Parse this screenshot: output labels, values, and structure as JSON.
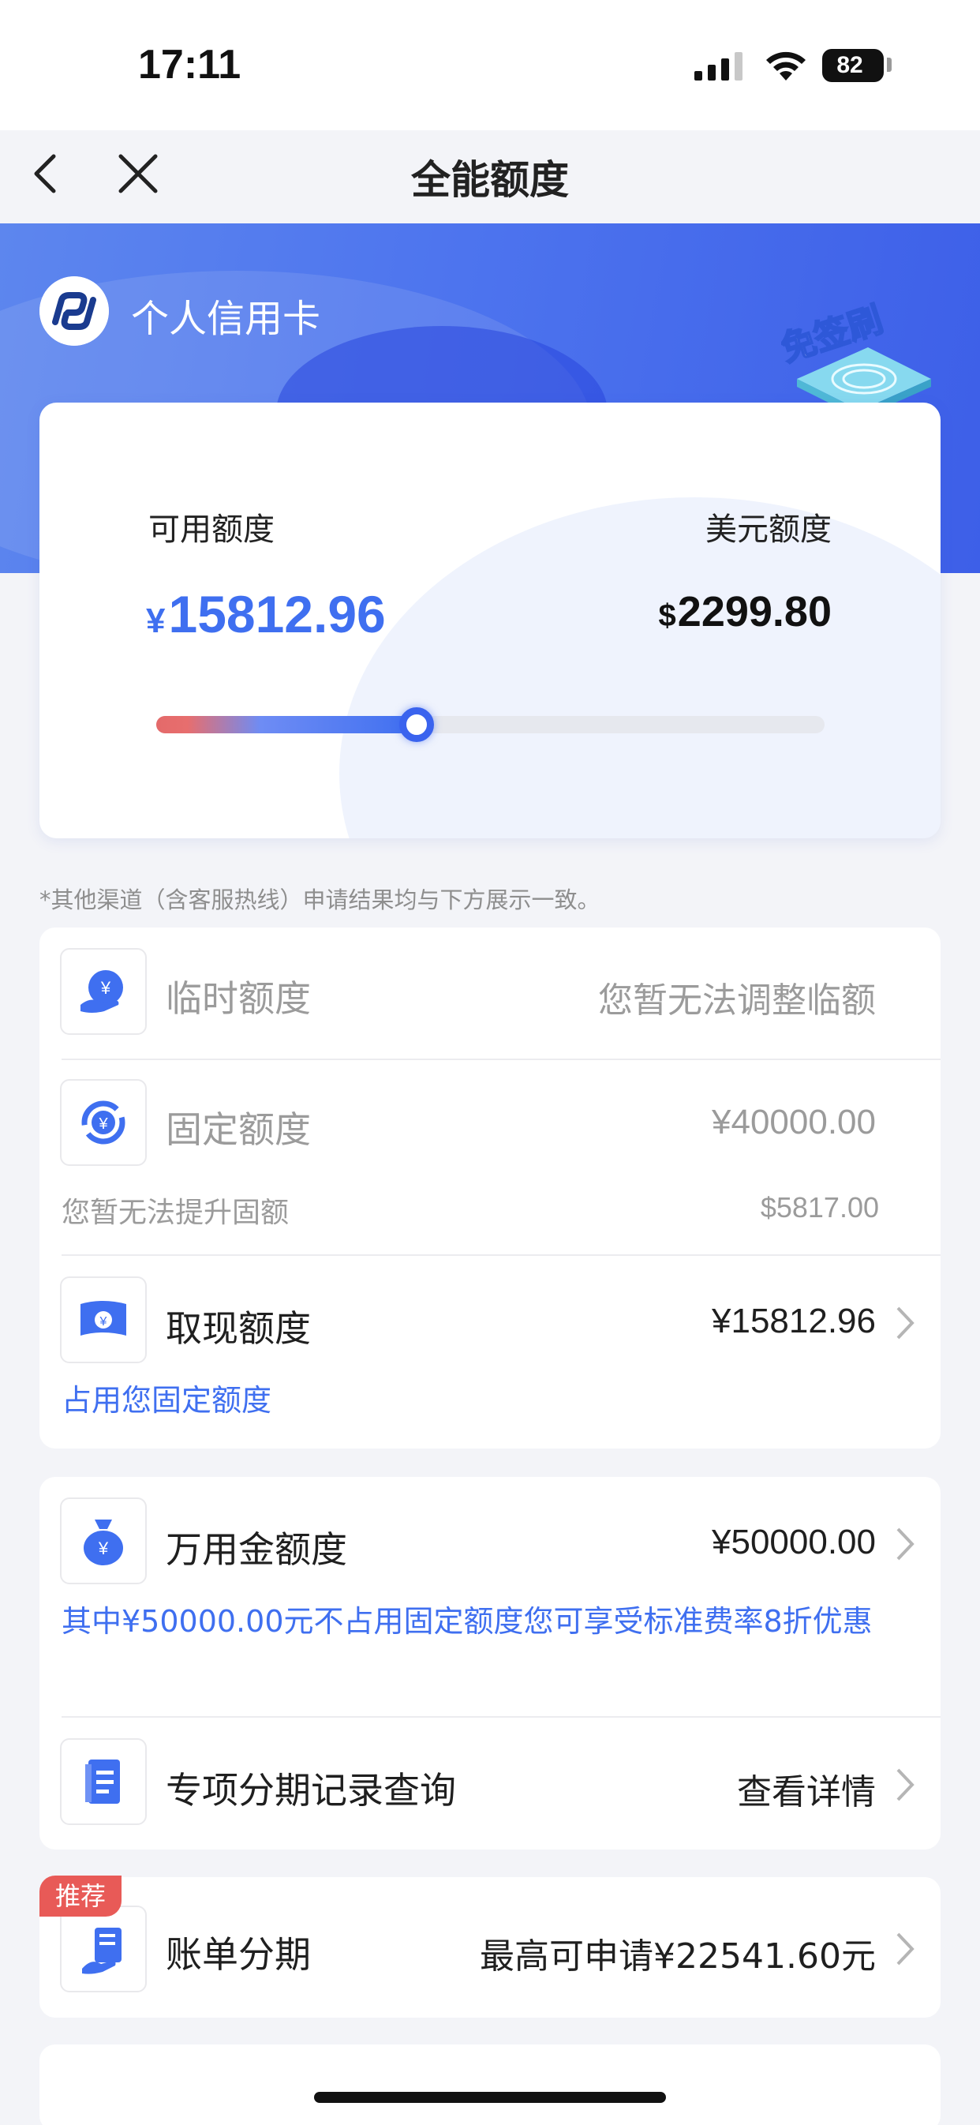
{
  "status_bar": {
    "time": "17:11",
    "battery": "82"
  },
  "nav": {
    "title": "全能额度"
  },
  "header": {
    "card_name": "个人信用卡",
    "badge_text": "免签刷"
  },
  "quota": {
    "available_label": "可用额度",
    "available_currency": "¥",
    "available_amount": "15812.96",
    "usd_label": "美元额度",
    "usd_currency": "$",
    "usd_amount": "2299.80",
    "used_ratio": 0.39
  },
  "note": "*其他渠道（含客服热线）申请结果均与下方展示一致。",
  "items": {
    "temp": {
      "title": "临时额度",
      "value": "您暂无法调整临额"
    },
    "fixed": {
      "title": "固定额度",
      "value": "¥40000.00",
      "sub_left": "您暂无法提升固额",
      "sub_right": "$5817.00"
    },
    "cash": {
      "title": "取现额度",
      "value": "¥15812.96",
      "sub": "占用您固定额度"
    },
    "wanyong": {
      "title": "万用金额度",
      "value": "¥50000.00",
      "sub": "其中¥50000.00元不占用固定额度您可享受标准费率8折优惠"
    },
    "special": {
      "title": "专项分期记录查询",
      "value": "查看详情"
    },
    "bill": {
      "tag": "推荐",
      "title": "账单分期",
      "value": "最高可申请¥22541.60元"
    }
  },
  "colors": {
    "accent": "#3f6ff0",
    "recommend_tag": "#e85a57",
    "header_blue": "#4d74ee"
  }
}
